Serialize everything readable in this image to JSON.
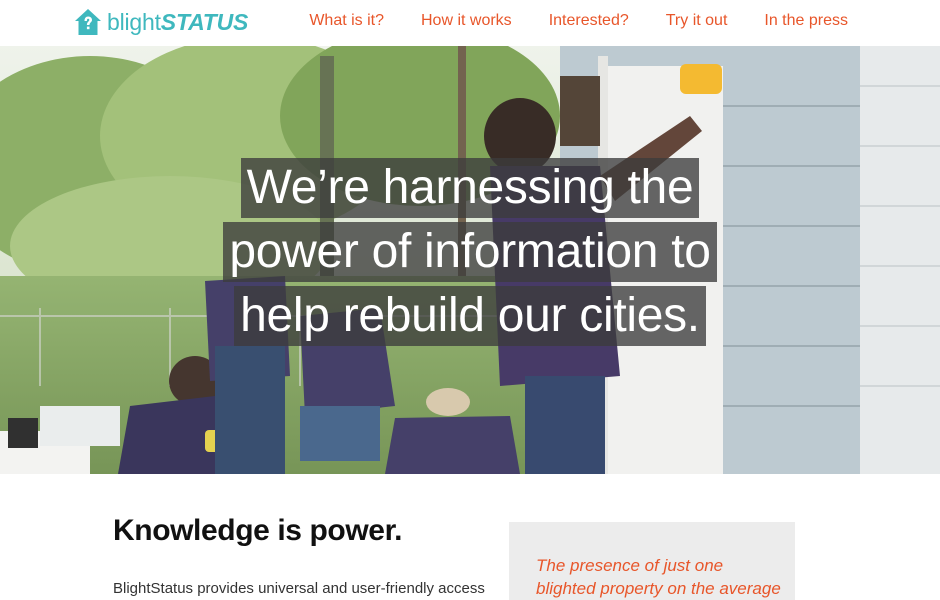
{
  "brand": {
    "name_part1": "blight",
    "name_part2": "STATUS",
    "color": "#3fb8be"
  },
  "nav": {
    "accent": "#e8562a",
    "items": [
      {
        "label": "What is it?"
      },
      {
        "label": "How it works"
      },
      {
        "label": "Interested?"
      },
      {
        "label": "Try it out"
      },
      {
        "label": "In the press"
      }
    ]
  },
  "hero": {
    "lines": [
      "We’re harnessing the",
      "power of information to",
      "help rebuild our cities."
    ]
  },
  "content": {
    "title": "Knowledge is power.",
    "body": "BlightStatus provides universal and user-friendly access",
    "quote": "The presence of just one blighted property on the average"
  }
}
